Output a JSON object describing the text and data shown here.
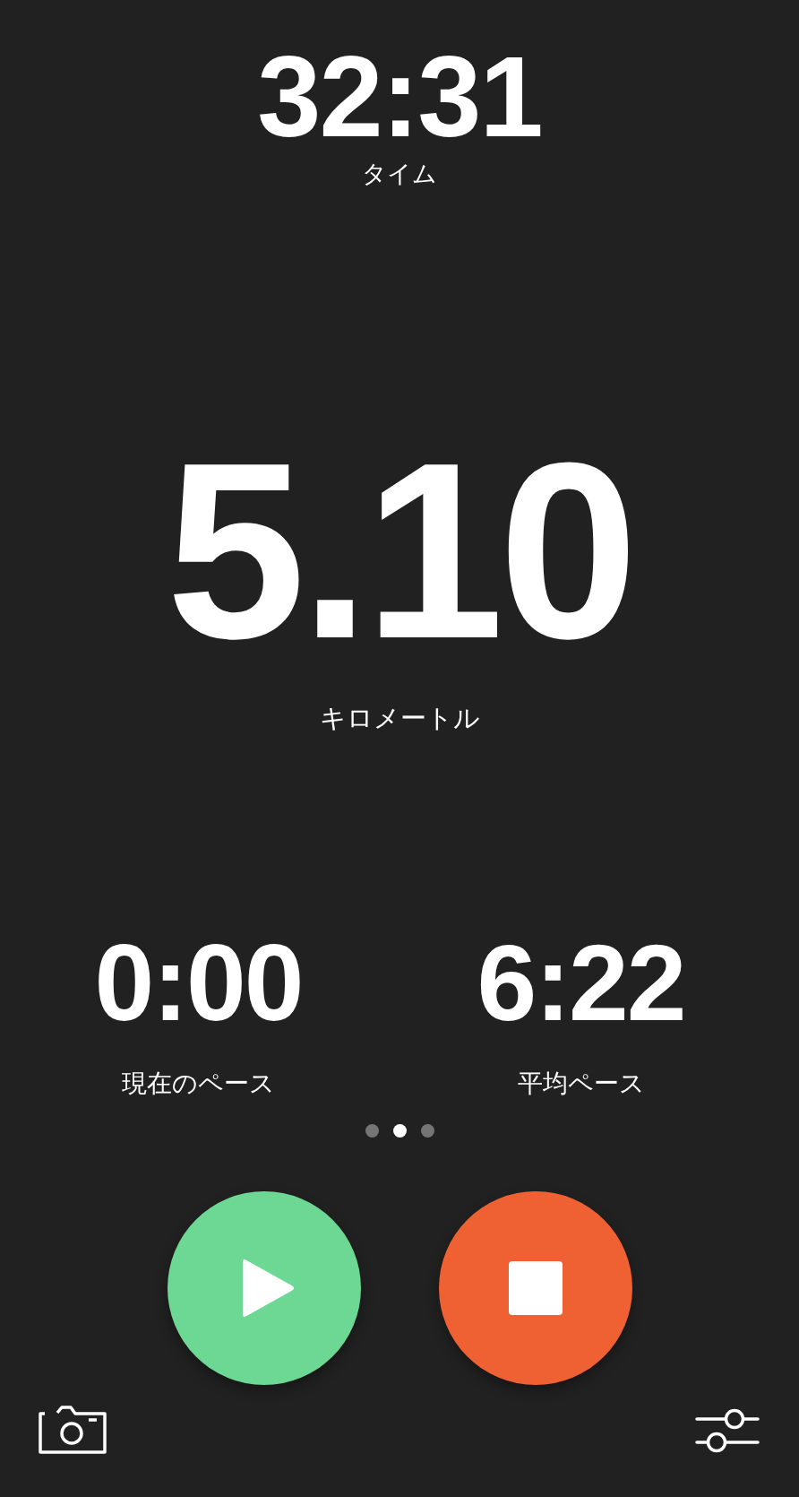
{
  "time": {
    "value": "32:31",
    "label": "タイム"
  },
  "distance": {
    "value": "5.10",
    "label": "キロメートル"
  },
  "paces": [
    {
      "value": "0:00",
      "label": "現在のペース"
    },
    {
      "value": "6:22",
      "label": "平均ペース"
    }
  ],
  "page_dots": [
    {
      "selected": false
    },
    {
      "selected": true
    },
    {
      "selected": false
    }
  ],
  "controls": [
    {
      "kind": "play",
      "color": "#6cd893"
    },
    {
      "kind": "stop",
      "color": "#ef6133"
    }
  ]
}
